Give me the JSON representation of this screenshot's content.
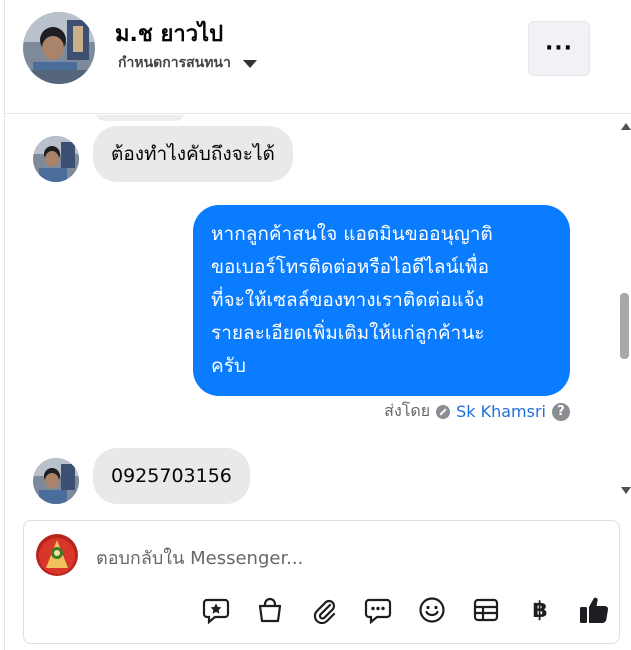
{
  "header": {
    "contact_name": "ม.ช ยาวไป",
    "subtitle": "กำหนดการสนทนา",
    "more_label": "···"
  },
  "messages": [
    {
      "direction": "incoming",
      "text": "ต้องทำไงคับถึงจะได้"
    },
    {
      "direction": "outgoing",
      "lines": [
        "หากลูกค้าสนใจ แอดมินขออนุญาติ",
        "ขอเบอร์โทรติดต่อหรือไอดีไลน์เพื่อ",
        "ที่จะให้เซลล์ของทางเราติดต่อแจ้ง",
        "รายละเอียดเพิ่มเติมให้แก่ลูกค้านะ",
        "ครับ"
      ]
    },
    {
      "direction": "incoming",
      "text": "0925703156"
    }
  ],
  "sent_by": {
    "prefix": "ส่งโดย",
    "name": "Sk Khamsri",
    "help_glyph": "?"
  },
  "composer": {
    "placeholder": "ตอบกลับใน Messenger...",
    "value": "",
    "tools": [
      {
        "icon": "saved-reply-icon"
      },
      {
        "icon": "shopping-bag-icon"
      },
      {
        "icon": "paperclip-icon"
      },
      {
        "icon": "chat-bubble-icon"
      },
      {
        "icon": "emoji-icon"
      },
      {
        "icon": "form-table-icon"
      },
      {
        "icon": "baht-icon",
        "glyph": "฿"
      },
      {
        "icon": "thumbs-up-icon"
      }
    ]
  },
  "colors": {
    "outgoing_bubble": "#0a7cff",
    "incoming_bubble": "#e9e9eb",
    "sender_name": "#216fdb",
    "muted_text": "#65676b"
  }
}
